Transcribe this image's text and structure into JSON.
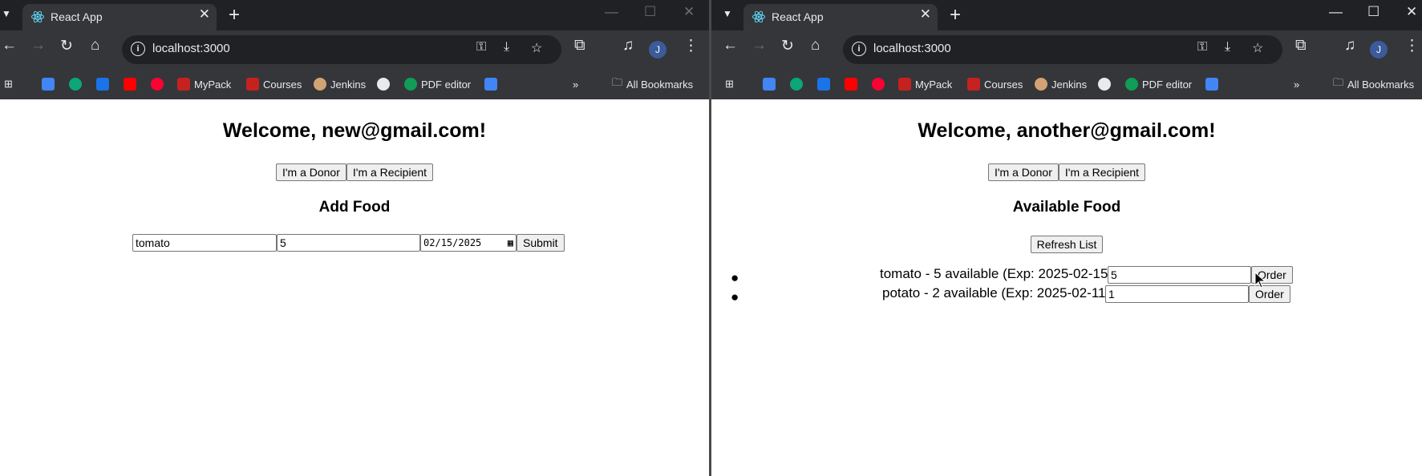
{
  "left": {
    "tab_title": "React App",
    "url": "localhost:3000",
    "bookmarks": [
      "MyPack",
      "Courses",
      "Jenkins",
      "PDF editor"
    ],
    "all_bookmarks": "All Bookmarks",
    "welcome": "Welcome, new@gmail.com!",
    "donor_button": "I'm a Donor",
    "recipient_button": "I'm a Recipient",
    "section_title": "Add Food",
    "form": {
      "food_name": "tomato",
      "quantity": "5",
      "date_month": "02",
      "date_day": "15",
      "date_year": "2025",
      "submit": "Submit"
    },
    "avatar_initial": "J"
  },
  "right": {
    "tab_title": "React App",
    "url": "localhost:3000",
    "bookmarks": [
      "MyPack",
      "Courses",
      "Jenkins",
      "PDF editor"
    ],
    "all_bookmarks": "All Bookmarks",
    "welcome": "Welcome, another@gmail.com!",
    "donor_button": "I'm a Donor",
    "recipient_button": "I'm a Recipient",
    "section_title": "Available Food",
    "refresh_button": "Refresh List",
    "items": [
      {
        "text": "tomato - 5 available (Exp: 2025-02-15)",
        "qty": "5",
        "order": "Order"
      },
      {
        "text": "potato - 2 available (Exp: 2025-02-11)",
        "qty": "1",
        "order": "Order"
      }
    ],
    "avatar_initial": "J"
  },
  "colors": {
    "chrome_dark": "#202124",
    "chrome_toolbar": "#35363a",
    "button_bg": "#efefef"
  }
}
